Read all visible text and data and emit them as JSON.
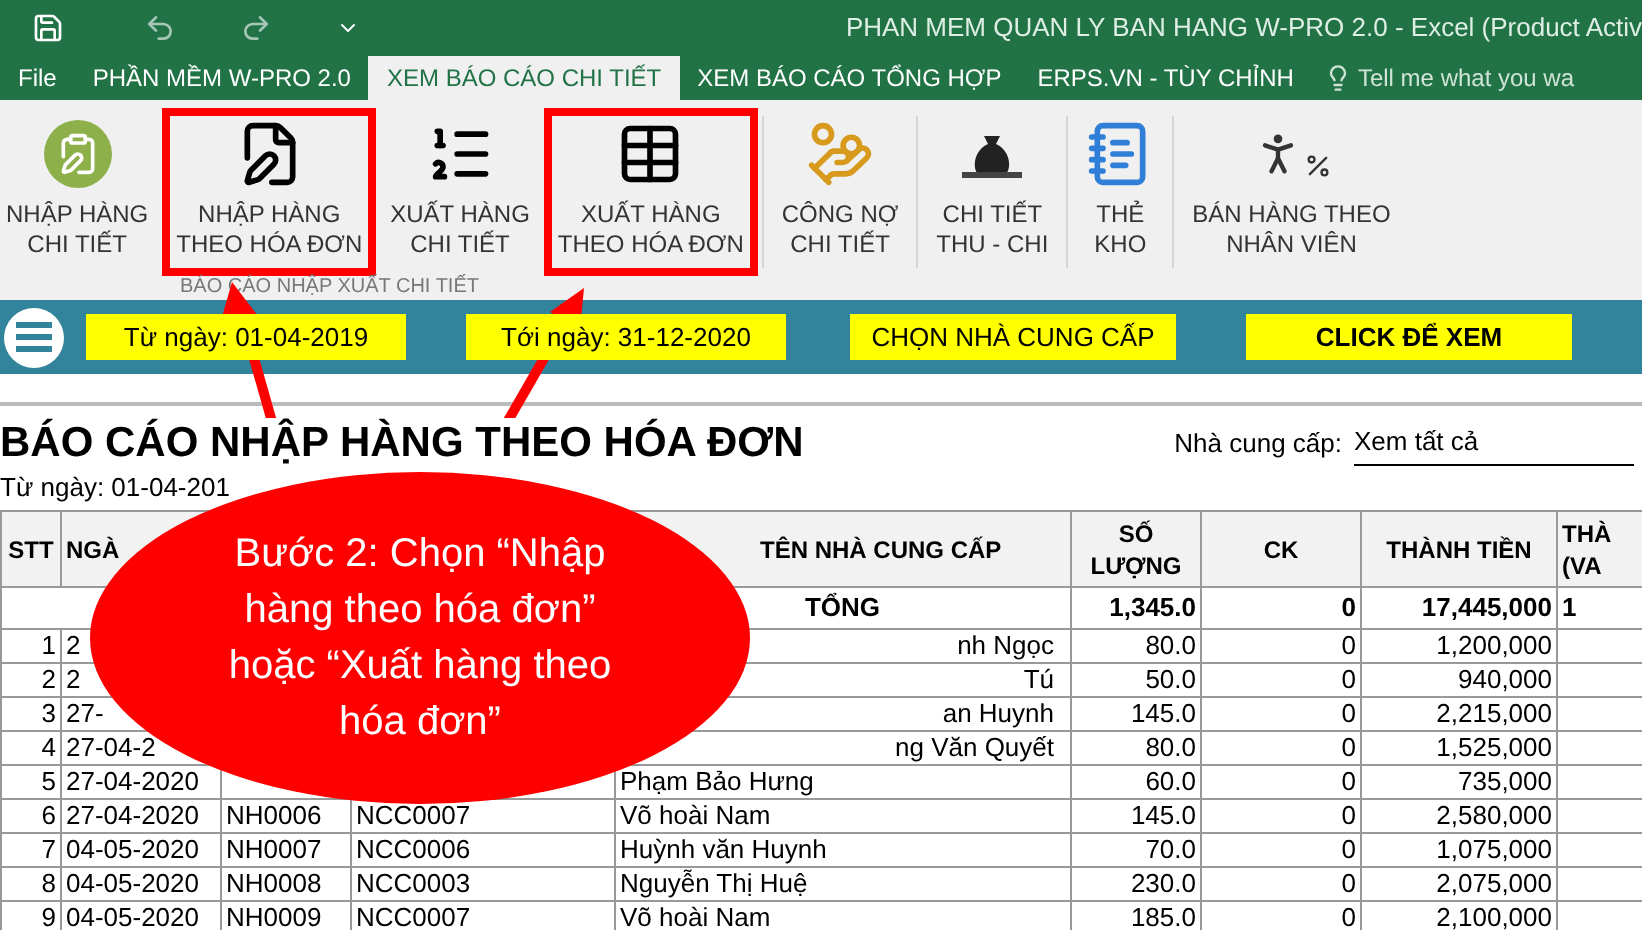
{
  "window": {
    "title": "PHAN MEM QUAN LY BAN HANG W-PRO 2.0 - Excel (Product Activ"
  },
  "tabs": [
    {
      "label": "File",
      "selected": false
    },
    {
      "label": "PHẦN MỀM W-PRO 2.0",
      "selected": false
    },
    {
      "label": "XEM BÁO CÁO CHI TIẾT",
      "selected": true
    },
    {
      "label": "XEM BÁO CÁO TỔNG HỢP",
      "selected": false
    },
    {
      "label": "ERPS.VN - TÙY CHỈNH",
      "selected": false
    }
  ],
  "tell_me": {
    "placeholder": "Tell me what you wa"
  },
  "ribbon": {
    "buttons": [
      {
        "lines": [
          "NHẬP HÀNG",
          "CHI TIẾT"
        ],
        "highlighted": false
      },
      {
        "lines": [
          "NHẬP HÀNG",
          "THEO HÓA ĐƠN"
        ],
        "highlighted": true
      },
      {
        "lines": [
          "XUẤT HÀNG",
          "CHI TIẾT"
        ],
        "highlighted": false
      },
      {
        "lines": [
          "XUẤT HÀNG",
          "THEO HÓA ĐƠN"
        ],
        "highlighted": true
      },
      {
        "lines": [
          "CÔNG NỢ",
          "CHI TIẾT"
        ],
        "highlighted": false
      },
      {
        "lines": [
          "CHI TIẾT",
          "THU - CHI"
        ],
        "highlighted": false
      },
      {
        "lines": [
          "THẺ",
          "KHO"
        ],
        "highlighted": false
      },
      {
        "lines": [
          "BÁN HÀNG THEO",
          "NHÂN VIÊN"
        ],
        "highlighted": false
      }
    ],
    "group_label": "BÁO CÁO NHẬP XUẤT CHI TIẾT"
  },
  "filter_bar": {
    "from_date": "Từ ngày: 01-04-2019",
    "to_date": "Tới ngày: 31-12-2020",
    "supplier_button": "CHỌN NHÀ CUNG CẤP",
    "view_button": "CLICK ĐỂ XEM"
  },
  "report": {
    "title": "BÁO CÁO NHẬP HÀNG THEO HÓA ĐƠN",
    "subtitle": "Từ ngày: 01-04-201",
    "supplier_label": "Nhà cung cấp:",
    "supplier_value": "Xem tất cả"
  },
  "table": {
    "columns": [
      {
        "lines": [
          "STT"
        ]
      },
      {
        "lines": [
          "NGÀ"
        ]
      },
      {},
      {},
      {
        "lines": [
          "TÊN NHÀ CUNG CẤP"
        ]
      },
      {
        "lines": [
          "SỐ",
          "LƯỢNG"
        ]
      },
      {
        "lines": [
          "CK"
        ]
      },
      {
        "lines": [
          "THÀNH TIỀN"
        ]
      },
      {
        "lines": [
          "THÀ",
          "(VA"
        ]
      }
    ],
    "total": {
      "label": "TỔNG",
      "qty": "1,345.0",
      "ck": "0",
      "amount": "17,445,000",
      "column_9": "1"
    },
    "rows": [
      {
        "stt": "1",
        "date": "2",
        "name": "nh Ngọc",
        "name_cut": true,
        "qty": "80.0",
        "ck": "0",
        "amount": "1,200,000"
      },
      {
        "stt": "2",
        "date": "2",
        "name": "Tú",
        "name_cut": true,
        "qty": "50.0",
        "ck": "0",
        "amount": "940,000"
      },
      {
        "stt": "3",
        "date": "27-",
        "name": "an Huynh",
        "name_cut": true,
        "qty": "145.0",
        "ck": "0",
        "amount": "2,215,000"
      },
      {
        "stt": "4",
        "date": "27-04-2",
        "name": "ng Văn Quyết",
        "name_cut": true,
        "qty": "80.0",
        "ck": "0",
        "amount": "1,525,000"
      },
      {
        "stt": "5",
        "date": "27-04-2020",
        "name": "Phạm Bảo Hưng",
        "name_cut": false,
        "qty": "60.0",
        "ck": "0",
        "amount": "735,000"
      },
      {
        "stt": "6",
        "date": "27-04-2020",
        "invoice": "NH0006",
        "supplier_code": "NCC0007",
        "name": "Võ hoài Nam",
        "name_cut": false,
        "qty": "145.0",
        "ck": "0",
        "amount": "2,580,000"
      },
      {
        "stt": "7",
        "date": "04-05-2020",
        "invoice": "NH0007",
        "supplier_code": "NCC0006",
        "name": "Huỳnh văn Huynh",
        "name_cut": false,
        "qty": "70.0",
        "ck": "0",
        "amount": "1,075,000"
      },
      {
        "stt": "8",
        "date": "04-05-2020",
        "invoice": "NH0008",
        "supplier_code": "NCC0003",
        "name": "Nguyễn Thị Huệ",
        "name_cut": false,
        "qty": "230.0",
        "ck": "0",
        "amount": "2,075,000"
      },
      {
        "stt": "9",
        "date": "04-05-2020",
        "invoice": "NH0009",
        "supplier_code": "NCC0007",
        "name": "Võ hoài Nam",
        "name_cut": false,
        "qty": "185.0",
        "ck": "0",
        "amount": "2,100,000"
      }
    ]
  },
  "callout": {
    "text": "Bước 2: Chọn “Nhập hàng theo hóa đơn” hoặc “Xuất hàng theo hóa đơn”"
  }
}
